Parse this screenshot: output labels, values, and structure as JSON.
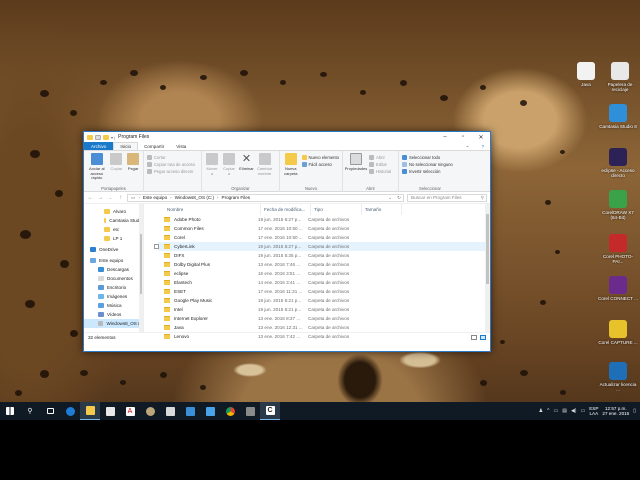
{
  "window": {
    "title": "Program Files"
  },
  "ribbon_tabs": [
    "Archivo",
    "Inicio",
    "Compartir",
    "Vista"
  ],
  "ribbon": {
    "portapapeles": {
      "name": "Portapapeles",
      "anclar": "Anclar al acceso rápido",
      "copiar": "Copiar",
      "pegar": "Pegar",
      "cortar": "Cortar",
      "copiar_ruta": "Copiar ruta de acceso",
      "pegar_acceso": "Pegar acceso directo"
    },
    "organizar": {
      "name": "Organizar",
      "mover": "Mover a",
      "copiar": "Copiar a",
      "eliminar": "Eliminar",
      "cambiar": "Cambiar nombre"
    },
    "nuevo": {
      "name": "Nuevo",
      "carpeta": "Nueva carpeta",
      "elemento": "Nuevo elemento",
      "facil": "Fácil acceso"
    },
    "abrir": {
      "name": "Abrir",
      "propiedades": "Propiedades",
      "abrir": "Abrir",
      "editar": "Editar",
      "historial": "Historial"
    },
    "seleccionar": {
      "name": "Seleccionar",
      "todo": "Seleccionar todo",
      "ninguno": "No seleccionar ninguno",
      "invertir": "Invertir selección"
    }
  },
  "address": {
    "crumbs": [
      "Este equipo",
      "Windows8_OS (C:)",
      "Program Files"
    ],
    "search_placeholder": "Buscar en Program Files"
  },
  "nav_pane": [
    {
      "label": "Alvaro",
      "icon": "folder-icon"
    },
    {
      "label": "Camtasia Studio",
      "icon": "folder-icon"
    },
    {
      "label": "etc",
      "icon": "folder-icon"
    },
    {
      "label": "LP 1",
      "icon": "folder-icon"
    },
    {
      "label": "OneDrive",
      "icon": "cloud-icon"
    },
    {
      "label": "Este equipo",
      "icon": "computer-icon"
    },
    {
      "label": "Descargas",
      "icon": "download-icon"
    },
    {
      "label": "Documentos",
      "icon": "document-icon"
    },
    {
      "label": "Escritorio",
      "icon": "desktop-icon"
    },
    {
      "label": "Imágenes",
      "icon": "picture-icon"
    },
    {
      "label": "Música",
      "icon": "music-icon"
    },
    {
      "label": "Vídeos",
      "icon": "video-icon"
    },
    {
      "label": "Windows8_OS (C",
      "icon": "drive-icon"
    }
  ],
  "columns": [
    "Nombre",
    "Fecha de modifica...",
    "Tipo",
    "Tamaño"
  ],
  "files": [
    {
      "name": "Adobe Photo",
      "date": "19 jun. 2015 5:27 p...",
      "type": "Carpeta de archivos"
    },
    {
      "name": "Common Files",
      "date": "17 ene. 2016 10:50 ...",
      "type": "Carpeta de archivos"
    },
    {
      "name": "Corel",
      "date": "17 ene. 2016 10:50 ...",
      "type": "Carpeta de archivos"
    },
    {
      "name": "CyberLink",
      "date": "19 jun. 2015 5:27 p...",
      "type": "Carpeta de archivos"
    },
    {
      "name": "DIFX",
      "date": "19 jun. 2015 5:35 p...",
      "type": "Carpeta de archivos"
    },
    {
      "name": "Dolby Digital Plus",
      "date": "13 ene. 2016 7:46 ...",
      "type": "Carpeta de archivos"
    },
    {
      "name": "eclipse",
      "date": "16 ene. 2016 3:51 ...",
      "type": "Carpeta de archivos"
    },
    {
      "name": "Elantech",
      "date": "14 ene. 2016 3:41 ...",
      "type": "Carpeta de archivos"
    },
    {
      "name": "ESET",
      "date": "17 ene. 2016 11:31 ...",
      "type": "Carpeta de archivos"
    },
    {
      "name": "Google Play Music",
      "date": "19 jun. 2015 5:21 p...",
      "type": "Carpeta de archivos"
    },
    {
      "name": "Intel",
      "date": "19 jun. 2015 5:21 p...",
      "type": "Carpeta de archivos"
    },
    {
      "name": "Internet Explorer",
      "date": "13 ene. 2016 8:37 ...",
      "type": "Carpeta de archivos"
    },
    {
      "name": "Java",
      "date": "13 ene. 2016 12:31 ...",
      "type": "Carpeta de archivos"
    },
    {
      "name": "Lenovo",
      "date": "13 ene. 2016 7:42 ...",
      "type": "Carpeta de archivos"
    }
  ],
  "status": {
    "count": "32 elementos"
  },
  "desktop_icons": [
    {
      "label": "Java",
      "color": "#f2f2f2"
    },
    {
      "label": "Papelera de reciclaje",
      "color": "#e8e8e8"
    },
    {
      "label": "Camtasia Studio 8",
      "color": "#2f8fd8"
    },
    {
      "label": "eclipse - Acceso directo",
      "color": "#2c2255"
    },
    {
      "label": "CorelDRAW X7 (64-Bit)",
      "color": "#3aa34a"
    },
    {
      "label": "Corel PHOTO-PAI...",
      "color": "#c52a2a"
    },
    {
      "label": "Corel CONNECT ...",
      "color": "#6b2b8c"
    },
    {
      "label": "Corel CAPTURE ...",
      "color": "#e7c22a"
    },
    {
      "label": "Actualizar licencia ...",
      "color": "#1f6fb8"
    }
  ],
  "tray": {
    "lang1": "ESP",
    "lang2": "LAA",
    "time": "12:57 p.m.",
    "date": "27 ene. 2016"
  },
  "colors": {
    "accent": "#1979ca",
    "taskbar": "#101a24",
    "folder": "#f5c94a"
  }
}
